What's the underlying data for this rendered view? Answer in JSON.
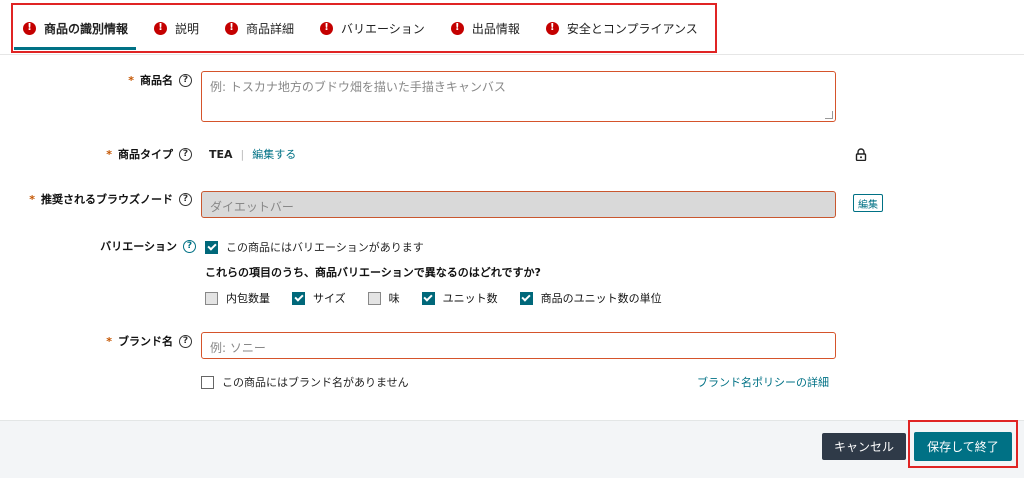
{
  "tabs": [
    {
      "label": "商品の識別情報",
      "error": true,
      "active": true
    },
    {
      "label": "説明",
      "error": true,
      "active": false
    },
    {
      "label": "商品詳細",
      "error": true,
      "active": false
    },
    {
      "label": "バリエーション",
      "error": true,
      "active": false
    },
    {
      "label": "出品情報",
      "error": true,
      "active": false
    },
    {
      "label": "安全とコンプライアンス",
      "error": true,
      "active": false
    }
  ],
  "form": {
    "product_name": {
      "label": "商品名",
      "placeholder": "例: トスカナ地方のブドウ畑を描いた手描きキャンバス"
    },
    "product_type": {
      "label": "商品タイプ",
      "value": "TEA",
      "separator": "|",
      "edit_link": "編集する"
    },
    "browse_node": {
      "label": "推奨されるブラウズノード",
      "placeholder": "ダイエットバー",
      "edit_button": "編集"
    },
    "variation": {
      "label": "バリエーション",
      "has_variations_label": "この商品にはバリエーションがあります",
      "has_variations_checked": true,
      "question": "これらの項目のうち、商品バリエーションで異なるのはどれですか?",
      "options": [
        {
          "label": "内包数量",
          "checked": false
        },
        {
          "label": "サイズ",
          "checked": true
        },
        {
          "label": "味",
          "checked": false
        },
        {
          "label": "ユニット数",
          "checked": true
        },
        {
          "label": "商品のユニット数の単位",
          "checked": true
        }
      ]
    },
    "brand": {
      "label": "ブランド名",
      "placeholder": "例: ソニー",
      "no_brand_label": "この商品にはブランド名がありません",
      "no_brand_checked": false,
      "policy_link": "ブランド名ポリシーの詳細"
    },
    "required_mark": "*",
    "help_glyph": "?"
  },
  "footer": {
    "cancel_label": "キャンセル",
    "save_label": "保存して終了"
  },
  "icons": {
    "error": "exclamation-circle-icon",
    "help": "question-circle-icon",
    "lock": "lock-icon"
  },
  "colors": {
    "accent": "#007185",
    "error": "#c40000",
    "input_border": "#d5542b",
    "cancel_bg": "#2f3a48"
  }
}
